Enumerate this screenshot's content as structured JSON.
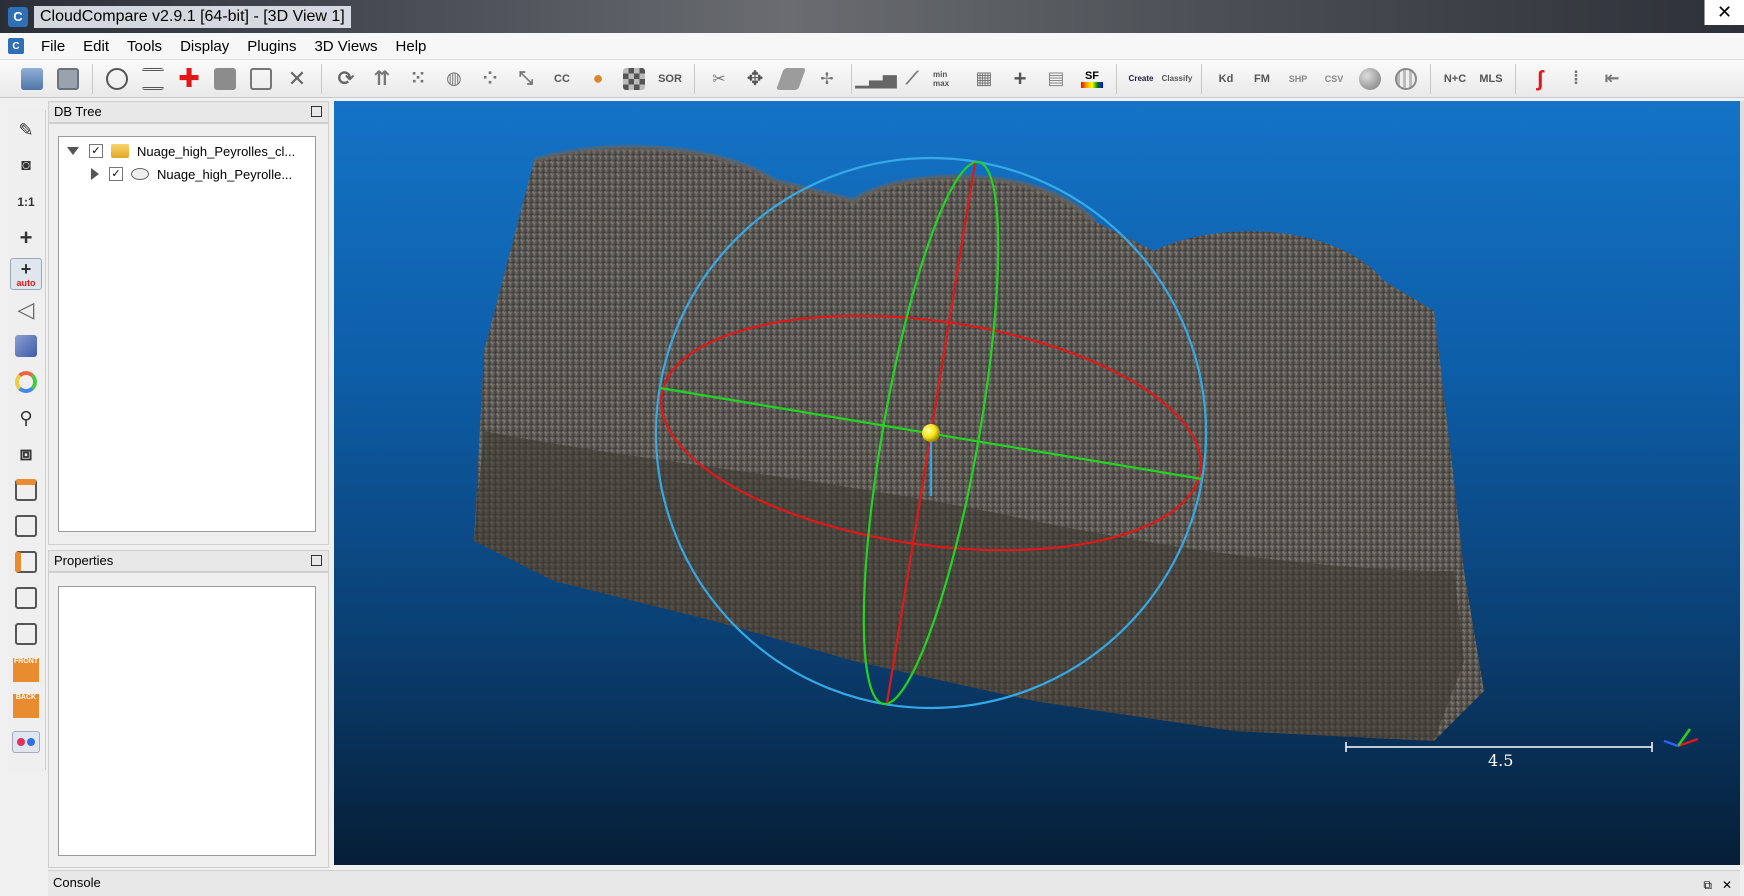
{
  "window": {
    "title": "CloudCompare v2.9.1 [64-bit] - [3D View 1]",
    "app_icon": "C",
    "close_glyph": "✕"
  },
  "menu": {
    "items": [
      "File",
      "Edit",
      "Tools",
      "Display",
      "Plugins",
      "3D Views",
      "Help"
    ]
  },
  "toolbar": {
    "labels": {
      "cc": "CC",
      "sor": "SOR",
      "minmax": "min max",
      "sf": "SF",
      "canupo_create": "Create",
      "canupo_classify": "Classify",
      "kd": "Kd",
      "fm": "FM",
      "shp": "SHP",
      "csv": "CSV",
      "nc": "N+C",
      "mls": "MLS"
    }
  },
  "left_toolbar": {
    "zoom_label": "1:1",
    "auto_label": "auto",
    "front_label": "FRONT",
    "back_label": "BACK"
  },
  "db_tree": {
    "title": "DB Tree",
    "items": [
      {
        "label": "Nuage_high_Peyrolles_cl...",
        "checked": true,
        "expanded": true,
        "type": "folder"
      },
      {
        "label": "Nuage_high_Peyrolle...",
        "checked": true,
        "expanded": false,
        "type": "cloud"
      }
    ]
  },
  "properties": {
    "title": "Properties"
  },
  "view": {
    "scale_value": "4.5"
  },
  "console": {
    "title": "Console",
    "float_glyph": "⧉",
    "close_glyph": "✕"
  },
  "colors": {
    "view_top": "#1473c6",
    "view_bottom": "#061e36",
    "sphere_blue": "#35a9e6",
    "axis_red": "#e01818",
    "axis_green": "#22d422",
    "center_yellow": "#f4e21b"
  }
}
